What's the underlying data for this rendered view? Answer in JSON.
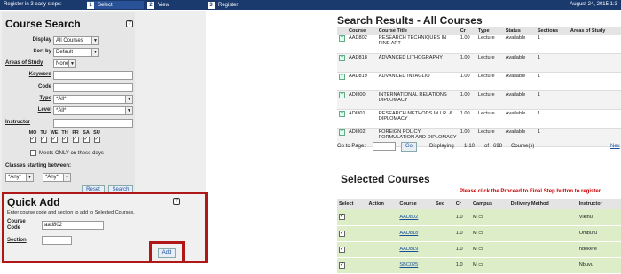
{
  "topbar": {
    "lead": "Register in 3 easy steps:",
    "steps": [
      {
        "num": "1",
        "label": "Select"
      },
      {
        "num": "2",
        "label": "View"
      },
      {
        "num": "3",
        "label": "Register"
      }
    ],
    "date": "August 24, 2015 1:3"
  },
  "search": {
    "title": "Course Search",
    "help": "?",
    "display_label": "Display",
    "display_value": "All Courses",
    "sortby_label": "Sort by",
    "sortby_value": "Default",
    "areas_label": "Areas of Study",
    "areas_value": "None",
    "keyword_label": "Keyword",
    "code_label": "Code",
    "type_label": "Type",
    "type_value": "*All*",
    "level_label": "Level",
    "level_value": "*All*",
    "instructor_label": "Instructor",
    "days": [
      "MO",
      "TU",
      "WE",
      "TH",
      "FR",
      "SA",
      "SU"
    ],
    "meets_only": "Meets ONLY on these days",
    "classes_between": "Classes starting between:",
    "start_from": "*Any*",
    "dash": "-",
    "start_to": "*Any*",
    "reset": "Reset",
    "search_btn": "Search"
  },
  "quickadd": {
    "title": "Quick Add",
    "help": "?",
    "instructions": "Enter course code and section to add to Selected Courses.",
    "course_code_label1": "Course",
    "course_code_label2": "Code",
    "course_code_value": "aad802",
    "section_label": "Section",
    "section_value": "",
    "add_btn": "Add"
  },
  "results": {
    "title": "Search Results -  All Courses",
    "columns": [
      "Course",
      "Course Title",
      "Cr",
      "Type",
      "Status",
      "Sections",
      "Areas of Study"
    ],
    "rows": [
      {
        "course": "AAD802",
        "title": "RESEARCH TECHNIQUES IN FINE ART",
        "cr": "1.00",
        "type": "Lecture",
        "status": "Available",
        "sections": "1"
      },
      {
        "course": "AAD818",
        "title": "ADVANCED LITHOGRAPHY",
        "cr": "1.00",
        "type": "Lecture",
        "status": "Available",
        "sections": "1"
      },
      {
        "course": "AAD819",
        "title": "ADVANCED INTAGLIO",
        "cr": "1.00",
        "type": "Lecture",
        "status": "Available",
        "sections": "1"
      },
      {
        "course": "ADI800",
        "title": "INTERNATIONAL RELATIONS DIPLOMACY",
        "cr": "1.00",
        "type": "Lecture",
        "status": "Available",
        "sections": "1"
      },
      {
        "course": "ADI801",
        "title": "RESEARCH METHODS IN I.R. & DIPLOMACY",
        "cr": "1.00",
        "type": "Lecture",
        "status": "Available",
        "sections": "1"
      },
      {
        "course": "ADI802",
        "title": "FOREIGN POLICY FORMULATION AND DIPLOMACY",
        "cr": "1.00",
        "type": "Lecture",
        "status": "Available",
        "sections": "1"
      }
    ],
    "goto_label": "Go to Page:",
    "go_btn": "Go",
    "displaying": "Displaying",
    "range": "1-10",
    "of": "of",
    "total": "698",
    "courses": "Course(s)",
    "next": "Nex"
  },
  "selected": {
    "title": "Selected Courses",
    "proceed_note": "Please click the Proceed to Final Step button to register",
    "columns": [
      "Select",
      "Action",
      "Course",
      "Sec",
      "Cr",
      "Campus",
      "Delivery Method",
      "Instructor"
    ],
    "rows": [
      {
        "course": "AAD802",
        "cr": "1.0",
        "campus": "M",
        "instructor": "Vikinu"
      },
      {
        "course": "AAD818",
        "cr": "1.0",
        "campus": "M",
        "instructor": "Omburu"
      },
      {
        "course": "AAD819",
        "cr": "1.0",
        "campus": "M",
        "instructor": "ndekere"
      },
      {
        "course": "SBC025",
        "cr": "1.0",
        "campus": "M",
        "instructor": "Nbuvu"
      }
    ]
  }
}
